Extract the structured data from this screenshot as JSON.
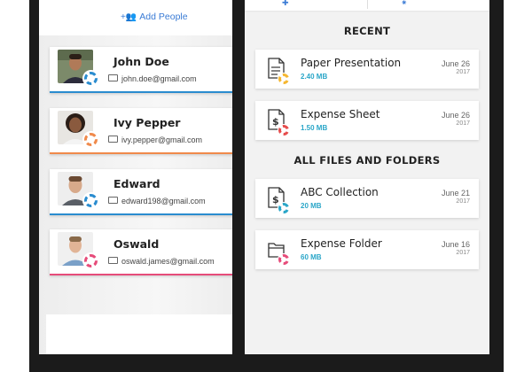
{
  "left": {
    "add_people_label": "Add People",
    "people": [
      {
        "name": "John Doe",
        "email": "john.doe@gmail.com",
        "color": "#2a8ccf"
      },
      {
        "name": "Ivy Pepper",
        "email": "ivy.pepper@gmail.com",
        "color": "#f08a4b"
      },
      {
        "name": "Edward",
        "email": "edward198@gmail.com",
        "color": "#2a8ccf"
      },
      {
        "name": "Oswald",
        "email": "oswald.james@gmail.com",
        "color": "#e64c7a"
      }
    ]
  },
  "right": {
    "recent_title": "RECENT",
    "all_title": "ALL FILES AND FOLDERS",
    "recent_files": [
      {
        "name": "Paper Presentation",
        "size": "2.40 MB",
        "date": "June 26",
        "year": "2017",
        "icon": "document-icon",
        "color": "#f5b731"
      },
      {
        "name": "Expense Sheet",
        "size": "1.50 MB",
        "date": "June 26",
        "year": "2017",
        "icon": "dollar-document-icon",
        "color": "#e64c4c"
      }
    ],
    "all_files": [
      {
        "name": "ABC Collection",
        "size": "20 MB",
        "date": "June 21",
        "year": "2017",
        "icon": "dollar-document-icon",
        "color": "#2aa6c8"
      },
      {
        "name": "Expense Folder",
        "size": "60 MB",
        "date": "June 16",
        "year": "2017",
        "icon": "folder-icon",
        "color": "#e64c7a"
      }
    ]
  }
}
